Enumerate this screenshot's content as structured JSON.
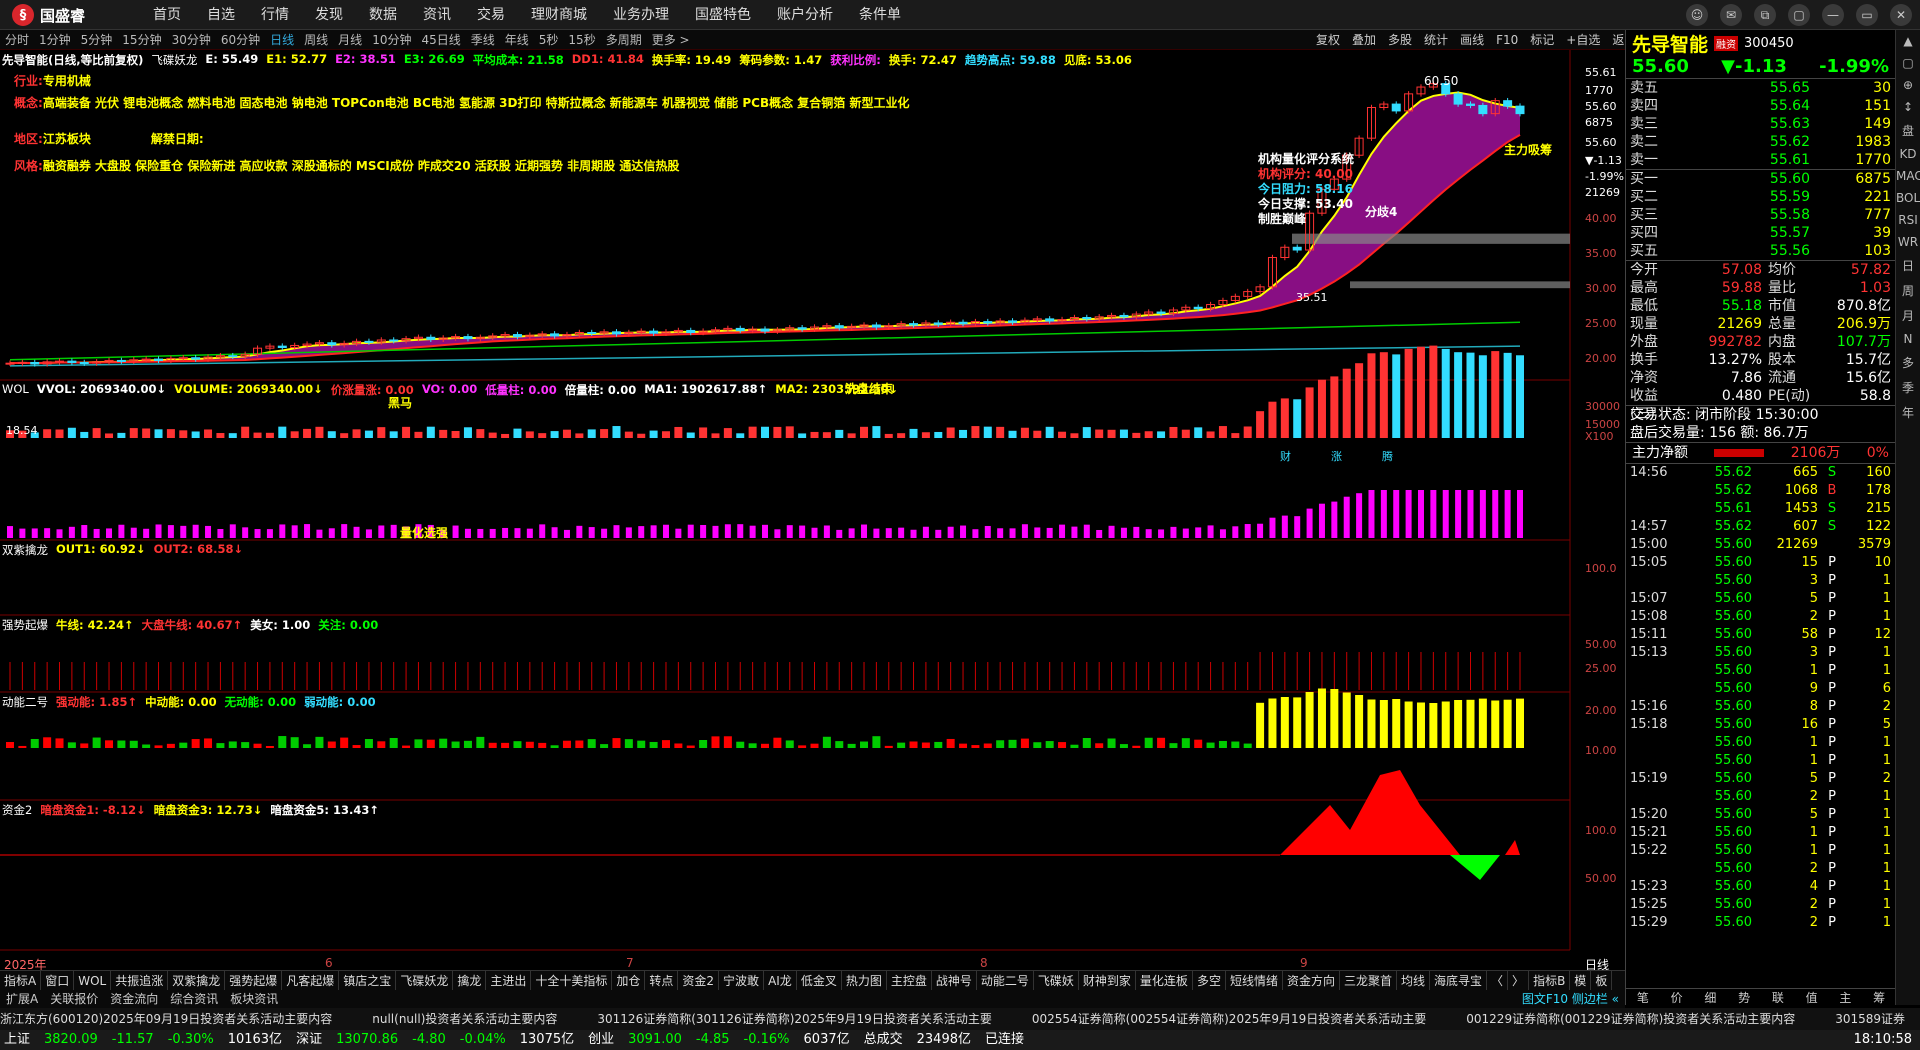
{
  "app": {
    "logo": "国盛睿",
    "menu": [
      "首页",
      "自选",
      "行情",
      "发现",
      "数据",
      "资讯",
      "交易",
      "理财商城",
      "业务办理",
      "国盛特色",
      "账户分析",
      "条件单"
    ]
  },
  "window_controls": [
    "☺",
    "✉",
    "⧉",
    "▢",
    "—",
    "▭",
    "✕"
  ],
  "periods": [
    "分时",
    "1分钟",
    "5分钟",
    "15分钟",
    "30分钟",
    "60分钟",
    "日线",
    "周线",
    "月线",
    "10分钟",
    "45日线",
    "季线",
    "年线",
    "5秒",
    "15秒",
    "多周期",
    "更多 >"
  ],
  "active_period": "日线",
  "tools": [
    "复权",
    "叠加",
    "多股",
    "统计",
    "画线",
    "F10",
    "标记",
    "+自选",
    "返回"
  ],
  "main_panel": {
    "title": "先导智能(日线,等比前复权)",
    "indicator": "飞碟妖龙",
    "values": [
      {
        "t": "E: 55.49",
        "c": "wht"
      },
      {
        "t": "E1: 52.77",
        "c": "yel"
      },
      {
        "t": "E2: 38.51",
        "c": "mag"
      },
      {
        "t": "E3: 26.69",
        "c": "green"
      },
      {
        "t": "平均成本: 21.58",
        "c": "green"
      },
      {
        "t": "DD1: 41.84",
        "c": "red"
      },
      {
        "t": "换手率: 19.49",
        "c": "yel"
      },
      {
        "t": "筹码参数: 1.47",
        "c": "yel"
      },
      {
        "t": "获利比例:",
        "c": "mag"
      },
      {
        "t": "换手: 72.47",
        "c": "yel"
      },
      {
        "t": "趋势高点: 59.88",
        "c": "cyan"
      },
      {
        "t": "见底: 53.06",
        "c": "yel"
      }
    ],
    "info_lines": [
      {
        "k": "行业:",
        "v": "专用机械"
      },
      {
        "k": "概念:",
        "v": "高端装备 光伏 锂电池概念 燃料电池 固态电池 钠电池 TOPCon电池 BC电池 氢能源 3D打印 特斯拉概念 新能源车 机器视觉 储能 PCB概念 复合铜箔 新型工业化"
      },
      {
        "k": "地区:",
        "v": "江苏板块",
        "k2": "解禁日期:"
      },
      {
        "k": "风格:",
        "v": "融资融券 大盘股 保险重仓 保险新进 高应收款 深股通标的 MSCI成份 昨成交20 活跃股 近期强势 非周期股 通达信热股"
      }
    ],
    "overlay": {
      "title": "机构量化评分系统",
      "score": "机构评分: 40.00",
      "resist": "今日阻力: 58.16",
      "support": "今日支撑: 53.40",
      "rule": "制胜巅峰",
      "fen": "分歧4",
      "mark1": "60.50",
      "mark2": "主力吸筹",
      "mark3": "35.51",
      "jiedi": "洗盘结束",
      "ll": "18.54",
      "ma": "黑马"
    },
    "yaxis": [
      "55.61",
      "1770",
      "55.60",
      "6875",
      "55.60",
      "▼-1.13",
      "-1.99%",
      "21269",
      "40.00",
      "35.00",
      "30.00",
      "25.00",
      "20.00"
    ],
    "markers": [
      "财",
      "涨",
      "腾"
    ]
  },
  "vol_panel": {
    "title": "WOL",
    "values": [
      {
        "t": "VVOL: 2069340.00↓",
        "c": "wht"
      },
      {
        "t": "VOLUME: 2069340.00↓",
        "c": "yel"
      },
      {
        "t": "价涨量涨: 0.00",
        "c": "red"
      },
      {
        "t": "VO: 0.00",
        "c": "mag"
      },
      {
        "t": "低量柱: 0.00",
        "c": "mag"
      },
      {
        "t": "倍量柱: 0.00",
        "c": "wht"
      },
      {
        "t": "MA1: 1902617.88↑",
        "c": "wht"
      },
      {
        "t": "MA2: 2303592.50↓",
        "c": "yel"
      }
    ],
    "yaxis": [
      "30000",
      "15000",
      "X100"
    ],
    "label": "量化选强"
  },
  "panel3": {
    "title": "双紫擒龙",
    "values": [
      {
        "t": "OUT1: 60.92↓",
        "c": "yel"
      },
      {
        "t": "OUT2: 68.58↓",
        "c": "red"
      }
    ],
    "yaxis": [
      "100.0"
    ]
  },
  "panel4": {
    "title": "强势起爆",
    "values": [
      {
        "t": "牛线: 42.24↑",
        "c": "yel"
      },
      {
        "t": "大盘牛线: 40.67↑",
        "c": "red"
      },
      {
        "t": "美女: 1.00",
        "c": "wht"
      },
      {
        "t": "关注: 0.00",
        "c": "green"
      }
    ],
    "yaxis": [
      "50.00",
      "25.00"
    ]
  },
  "panel5": {
    "title": "动能二号",
    "values": [
      {
        "t": "强动能: 1.85↑",
        "c": "red"
      },
      {
        "t": "中动能: 0.00",
        "c": "yel"
      },
      {
        "t": "无动能: 0.00",
        "c": "green"
      },
      {
        "t": "弱动能: 0.00",
        "c": "cyan"
      }
    ],
    "yaxis": [
      "20.00",
      "10.00"
    ]
  },
  "panel6": {
    "title": "资金2",
    "values": [
      {
        "t": "暗盘资金1: -8.12↓",
        "c": "red"
      },
      {
        "t": "暗盘资金3: 12.73↓",
        "c": "yel"
      },
      {
        "t": "暗盘资金5: 13.43↑",
        "c": "wht"
      }
    ],
    "yaxis": [
      "100.0",
      "50.00"
    ]
  },
  "xaxis": [
    "2025年",
    "6",
    "7",
    "8",
    "9"
  ],
  "xaxis_right": "日线",
  "bottom_tabs": [
    "指标A",
    "窗口",
    "WOL",
    "共振追涨",
    "双紫擒龙",
    "强势起爆",
    "凡客起爆",
    "镇店之宝",
    "飞碟妖龙",
    "擒龙",
    "主进出",
    "十全十美指标",
    "加仓",
    "转点",
    "资金2",
    "宁波敢",
    "AI龙",
    "低金叉",
    "热力图",
    "主控盘",
    "战神号",
    "动能二号",
    "飞碟妖",
    "财神到家",
    "量化连板",
    "多空",
    "短线情绪",
    "资金方向",
    "三龙聚首",
    "均线",
    "海底寻宝",
    "〈",
    "〉",
    "指标B",
    "模",
    "板"
  ],
  "footer_tabs": [
    "扩展A",
    "关联报价",
    "资金流向",
    "综合资讯",
    "板块资讯"
  ],
  "footer_right": "图文F10 侧边栏 «",
  "quote": {
    "name": "先导智能",
    "flag": "融资",
    "code": "300450",
    "price": "55.60",
    "change": "▼-1.13",
    "pct": "-1.99%",
    "sells": [
      {
        "l": "卖五",
        "p": "55.65",
        "v": "30"
      },
      {
        "l": "卖四",
        "p": "55.64",
        "v": "151"
      },
      {
        "l": "卖三",
        "p": "55.63",
        "v": "149"
      },
      {
        "l": "卖二",
        "p": "55.62",
        "v": "1983"
      },
      {
        "l": "卖一",
        "p": "55.61",
        "v": "1770"
      }
    ],
    "buys": [
      {
        "l": "买一",
        "p": "55.60",
        "v": "6875"
      },
      {
        "l": "买二",
        "p": "55.59",
        "v": "221"
      },
      {
        "l": "买三",
        "p": "55.58",
        "v": "777"
      },
      {
        "l": "买四",
        "p": "55.57",
        "v": "39"
      },
      {
        "l": "买五",
        "p": "55.56",
        "v": "103"
      }
    ],
    "stats": [
      {
        "a": "今开",
        "b": "57.08",
        "bc": "red",
        "c": "均价",
        "d": "57.82",
        "dc": "red"
      },
      {
        "a": "最高",
        "b": "59.88",
        "bc": "red",
        "c": "量比",
        "d": "1.03",
        "dc": "red"
      },
      {
        "a": "最低",
        "b": "55.18",
        "bc": "green",
        "c": "市值",
        "d": "870.8亿",
        "dc": "wht"
      },
      {
        "a": "现量",
        "b": "21269",
        "bc": "yel",
        "c": "总量",
        "d": "206.9万",
        "dc": "yel"
      },
      {
        "a": "外盘",
        "b": "992782",
        "bc": "red",
        "c": "内盘",
        "d": "107.7万",
        "dc": "green"
      },
      {
        "a": "换手",
        "b": "13.27%",
        "bc": "wht",
        "c": "股本",
        "d": "15.7亿",
        "dc": "wht"
      },
      {
        "a": "净资",
        "b": "7.86",
        "bc": "wht",
        "c": "流通",
        "d": "15.6亿",
        "dc": "wht"
      },
      {
        "a": "收益(三)",
        "b": "0.480",
        "bc": "wht",
        "c": "PE(动)",
        "d": "58.8",
        "dc": "wht"
      }
    ],
    "status": "交易状态: 闭市阶段 15:30:00",
    "after": "盘后交易量: 156  额: 86.7万",
    "main_label": "主力净额",
    "main_val": "2106万",
    "main_pct": "0%"
  },
  "ticks": [
    {
      "t": "14:56",
      "p": "55.62",
      "v": "665",
      "s": "S",
      "n": "160"
    },
    {
      "t": "",
      "p": "55.62",
      "v": "1068",
      "s": "B",
      "n": "178"
    },
    {
      "t": "",
      "p": "55.61",
      "v": "1453",
      "s": "S",
      "n": "215"
    },
    {
      "t": "14:57",
      "p": "55.62",
      "v": "607",
      "s": "S",
      "n": "122"
    },
    {
      "t": "15:00",
      "p": "55.60",
      "v": "21269",
      "s": "",
      "n": "3579"
    },
    {
      "t": "15:05",
      "p": "55.60",
      "v": "15",
      "s": "P",
      "n": "10"
    },
    {
      "t": "",
      "p": "55.60",
      "v": "3",
      "s": "P",
      "n": "1"
    },
    {
      "t": "15:07",
      "p": "55.60",
      "v": "5",
      "s": "P",
      "n": "1"
    },
    {
      "t": "15:08",
      "p": "55.60",
      "v": "2",
      "s": "P",
      "n": "1"
    },
    {
      "t": "15:11",
      "p": "55.60",
      "v": "58",
      "s": "P",
      "n": "12"
    },
    {
      "t": "15:13",
      "p": "55.60",
      "v": "3",
      "s": "P",
      "n": "1"
    },
    {
      "t": "",
      "p": "55.60",
      "v": "1",
      "s": "P",
      "n": "1"
    },
    {
      "t": "",
      "p": "55.60",
      "v": "9",
      "s": "P",
      "n": "6"
    },
    {
      "t": "15:16",
      "p": "55.60",
      "v": "8",
      "s": "P",
      "n": "2"
    },
    {
      "t": "15:18",
      "p": "55.60",
      "v": "16",
      "s": "P",
      "n": "5"
    },
    {
      "t": "",
      "p": "55.60",
      "v": "1",
      "s": "P",
      "n": "1"
    },
    {
      "t": "",
      "p": "55.60",
      "v": "1",
      "s": "P",
      "n": "1"
    },
    {
      "t": "15:19",
      "p": "55.60",
      "v": "5",
      "s": "P",
      "n": "2"
    },
    {
      "t": "",
      "p": "55.60",
      "v": "2",
      "s": "P",
      "n": "1"
    },
    {
      "t": "15:20",
      "p": "55.60",
      "v": "5",
      "s": "P",
      "n": "1"
    },
    {
      "t": "15:21",
      "p": "55.60",
      "v": "1",
      "s": "P",
      "n": "1"
    },
    {
      "t": "15:22",
      "p": "55.60",
      "v": "1",
      "s": "P",
      "n": "1"
    },
    {
      "t": "",
      "p": "55.60",
      "v": "2",
      "s": "P",
      "n": "1"
    },
    {
      "t": "15:23",
      "p": "55.60",
      "v": "4",
      "s": "P",
      "n": "1"
    },
    {
      "t": "15:25",
      "p": "55.60",
      "v": "2",
      "s": "P",
      "n": "1"
    },
    {
      "t": "15:29",
      "p": "55.60",
      "v": "2",
      "s": "P",
      "n": "1"
    }
  ],
  "rp_bottom_tabs": [
    "笔",
    "价",
    "细",
    "势",
    "联",
    "值",
    "主",
    "筹"
  ],
  "side_tabs": [
    "▲",
    "▢",
    "⊕",
    "↕",
    "盘",
    "KD",
    "MACD",
    "BOLL",
    "RSI",
    "WR",
    "日",
    "周",
    "月",
    "N",
    "多",
    "季",
    "年"
  ],
  "news": [
    "浙江东方(600120)2025年09月19日投资者关系活动主要内容",
    "null(null)投资者关系活动主要内容",
    "301126证券简称(301126证券简称)2025年9月19日投资者关系活动主要",
    "002554证券简称(002554证券简称)2025年9月19日投资者关系活动主要",
    "001229证券简称(001229证券简称)投资者关系活动主要内容",
    "301589证券"
  ],
  "status": {
    "sh_label": "上证",
    "sh": "3820.09",
    "sh_chg": "-11.57",
    "sh_pct": "-0.30%",
    "sh_amt": "10163亿",
    "sz_label": "深证",
    "sz": "13070.86",
    "sz_chg": "-4.80",
    "sz_pct": "-0.04%",
    "sz_amt": "13075亿",
    "cy_label": "创业",
    "cy": "3091.00",
    "cy_chg": "-4.85",
    "cy_pct": "-0.16%",
    "cy_amt": "6037亿",
    "total_label": "总成交",
    "total": "23498亿",
    "conn": "已连接",
    "time": "18:10:58"
  },
  "chart_data": {
    "type": "candlestick",
    "ylim": [
      18,
      62
    ],
    "close": [
      19.0,
      19.1,
      18.9,
      19.2,
      19.3,
      19.1,
      19.0,
      19.2,
      19.4,
      19.3,
      19.5,
      19.6,
      19.4,
      19.7,
      19.8,
      19.6,
      19.9,
      20.1,
      20.0,
      20.3,
      21.2,
      21.5,
      21.3,
      21.6,
      21.8,
      22.0,
      21.7,
      21.9,
      22.2,
      22.1,
      22.4,
      22.3,
      22.6,
      22.8,
      22.5,
      22.7,
      22.9,
      22.6,
      22.8,
      23.0,
      23.2,
      22.9,
      23.1,
      23.3,
      23.0,
      23.2,
      23.5,
      23.4,
      23.6,
      23.3,
      23.5,
      23.7,
      23.4,
      23.6,
      23.8,
      23.5,
      23.7,
      23.9,
      24.1,
      23.8,
      24.0,
      23.7,
      23.9,
      24.2,
      24.0,
      24.3,
      24.5,
      24.2,
      24.4,
      24.6,
      24.3,
      24.5,
      24.8,
      24.6,
      24.9,
      24.7,
      25.0,
      24.8,
      25.1,
      24.9,
      25.2,
      25.0,
      25.3,
      25.5,
      25.2,
      25.4,
      25.7,
      25.5,
      25.8,
      26.0,
      25.8,
      26.2,
      26.5,
      26.3,
      26.8,
      27.2,
      27.0,
      27.6,
      28.2,
      28.8,
      29.5,
      30.2,
      34.5,
      36.0,
      35.6,
      41.0,
      44.5,
      46.0,
      49.5,
      52.0,
      56.5,
      57.0,
      56.0,
      58.5,
      59.5,
      60.0,
      58.5,
      57.0,
      56.8,
      55.6,
      57.5,
      56.7,
      55.6
    ]
  }
}
